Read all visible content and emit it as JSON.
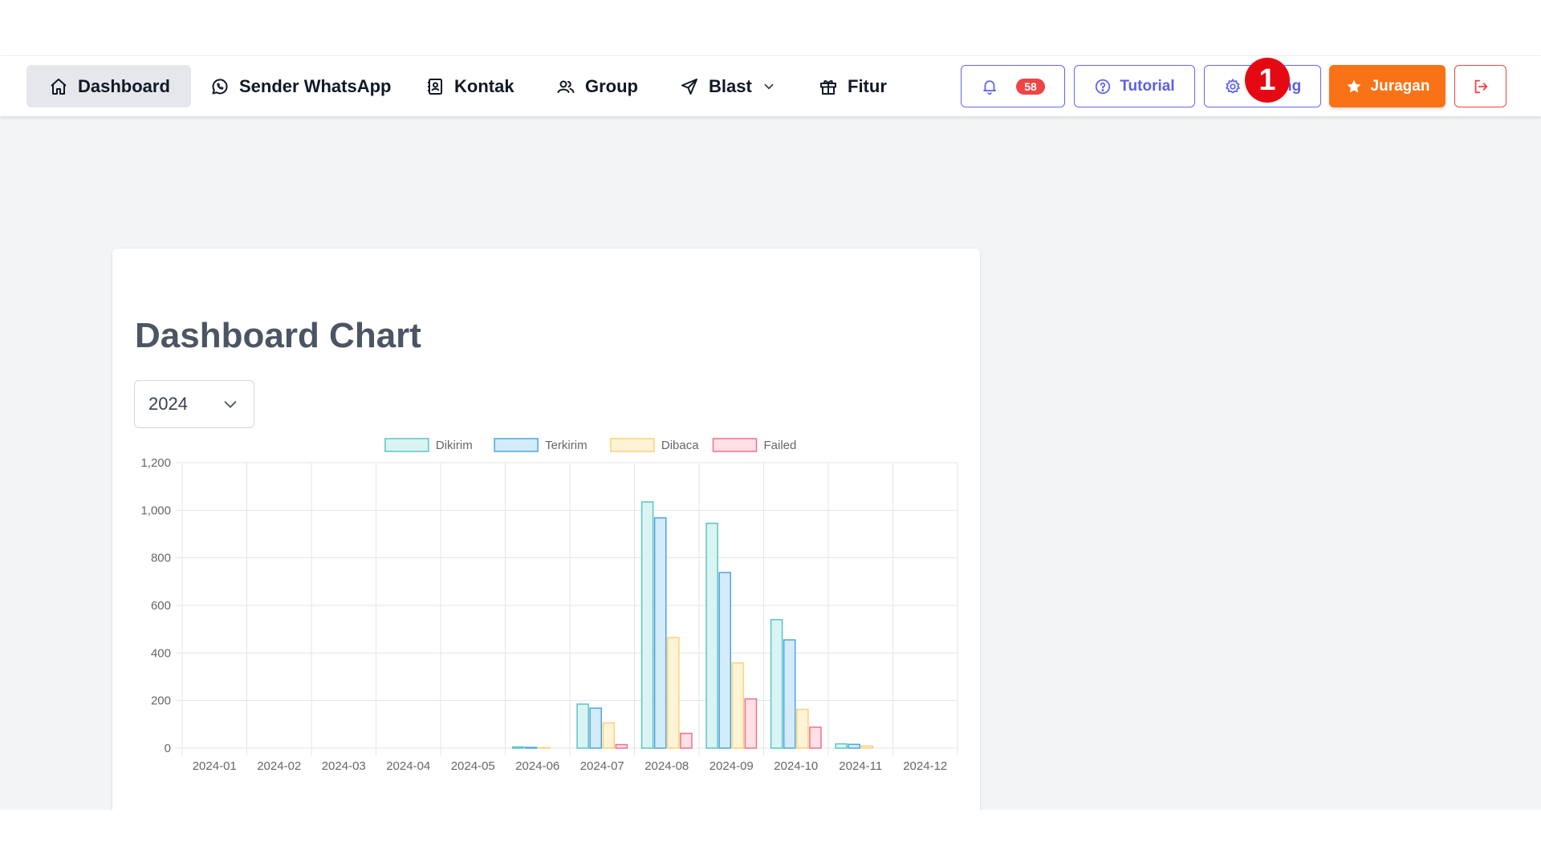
{
  "nav": {
    "items": [
      {
        "label": "Dashboard",
        "icon": "home-icon",
        "active": true
      },
      {
        "label": "Sender WhatsApp",
        "icon": "whatsapp-icon"
      },
      {
        "label": "Kontak",
        "icon": "contact-book-icon"
      },
      {
        "label": "Group",
        "icon": "users-icon"
      },
      {
        "label": "Blast",
        "icon": "send-icon",
        "dropdown": true
      },
      {
        "label": "Fitur",
        "icon": "gift-icon"
      }
    ],
    "notification_count": "58",
    "tutorial_label": "Tutorial",
    "setting_label": "Setting",
    "juragan_label": "Juragan",
    "marker": "1"
  },
  "colors": {
    "accent": "#6366f1",
    "primary": "#f97316",
    "danger": "#ef4444"
  },
  "card": {
    "title": "Dashboard Chart",
    "year": "2024"
  },
  "chart_data": {
    "type": "bar",
    "categories": [
      "2024-01",
      "2024-02",
      "2024-03",
      "2024-04",
      "2024-05",
      "2024-06",
      "2024-07",
      "2024-08",
      "2024-09",
      "2024-10",
      "2024-11",
      "2024-12"
    ],
    "series": [
      {
        "name": "Dikirim",
        "fill": "#d9f4f2",
        "stroke": "#5ec4c4",
        "values": [
          0,
          0,
          0,
          0,
          0,
          5,
          185,
          1035,
          945,
          540,
          18,
          0
        ]
      },
      {
        "name": "Terkirim",
        "fill": "#d3ebfa",
        "stroke": "#4fa5e0",
        "values": [
          0,
          0,
          0,
          0,
          0,
          3,
          168,
          968,
          738,
          455,
          16,
          0
        ]
      },
      {
        "name": "Dibaca",
        "fill": "#fff3d6",
        "stroke": "#fbd27a",
        "values": [
          0,
          0,
          0,
          0,
          0,
          2,
          106,
          465,
          358,
          163,
          9,
          0
        ]
      },
      {
        "name": "Failed",
        "fill": "#ffe0e6",
        "stroke": "#f2708d",
        "values": [
          0,
          0,
          0,
          0,
          0,
          0,
          15,
          62,
          207,
          88,
          0,
          0
        ]
      }
    ],
    "yticks": [
      "0",
      "200",
      "400",
      "600",
      "800",
      "1,000",
      "1,200"
    ],
    "ylim": [
      0,
      1200
    ],
    "grid": true,
    "legend": "top"
  }
}
